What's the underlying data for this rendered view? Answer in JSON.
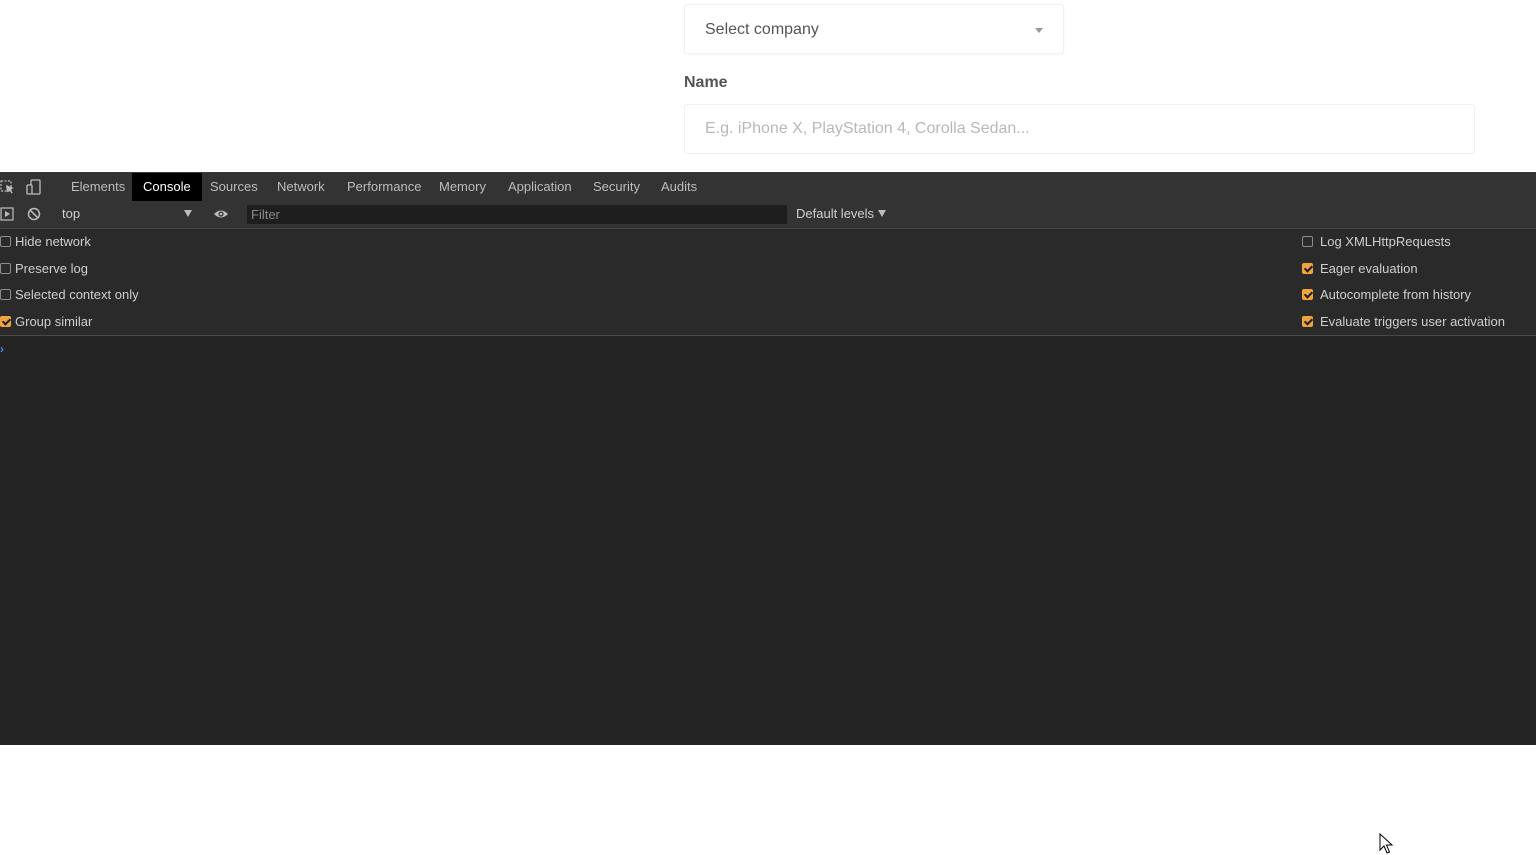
{
  "page": {
    "company_select": {
      "value": "Select company"
    },
    "name_field": {
      "label": "Name",
      "placeholder": "E.g. iPhone X, PlayStation 4, Corolla Sedan..."
    }
  },
  "devtools": {
    "tabs": [
      "Elements",
      "Console",
      "Sources",
      "Network",
      "Performance",
      "Memory",
      "Application",
      "Security",
      "Audits"
    ],
    "active_tab": "Console",
    "toolbar": {
      "context": "top",
      "filter_placeholder": "Filter",
      "levels": "Default levels"
    },
    "settings_left": [
      {
        "label": "Hide network",
        "checked": false
      },
      {
        "label": "Preserve log",
        "checked": false
      },
      {
        "label": "Selected context only",
        "checked": false
      },
      {
        "label": "Group similar",
        "checked": true
      }
    ],
    "settings_right": [
      {
        "label": "Log XMLHttpRequests",
        "checked": false
      },
      {
        "label": "Eager evaluation",
        "checked": true
      },
      {
        "label": "Autocomplete from history",
        "checked": true
      },
      {
        "label": "Evaluate triggers user activation",
        "checked": true
      }
    ],
    "prompt": "›"
  },
  "colors": {
    "devtools_bg": "#242424",
    "toolbar_bg": "#333333",
    "active_tab_bg": "#000000",
    "checkbox_accent": "#f0a43c",
    "prompt_blue": "#3d8fe0"
  },
  "icons": [
    "inspect-element-icon",
    "device-toggle-icon",
    "sidebar-toggle-icon",
    "clear-console-icon",
    "eye-icon",
    "mouse-cursor-icon"
  ]
}
